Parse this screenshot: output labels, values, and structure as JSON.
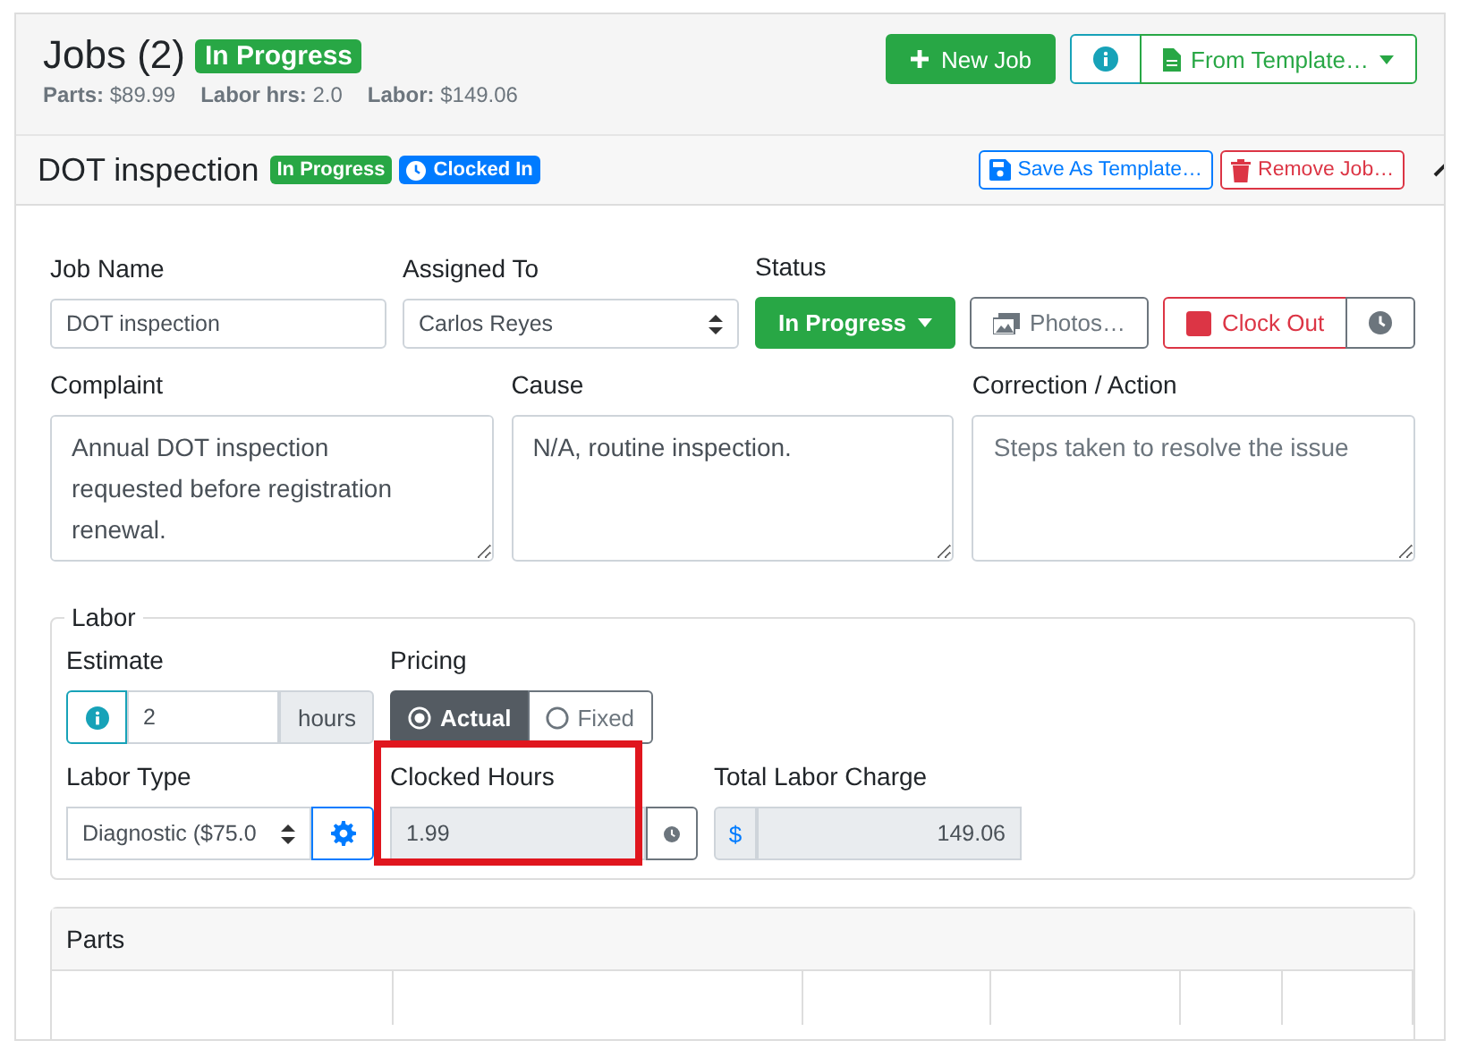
{
  "header": {
    "title": "Jobs (2)",
    "status_badge": "In Progress",
    "summary": [
      {
        "label": "Parts:",
        "value": "$89.99"
      },
      {
        "label": "Labor hrs:",
        "value": "2.0"
      },
      {
        "label": "Labor:",
        "value": "$149.06"
      }
    ],
    "new_job_button": "New Job",
    "from_template_button": "From Template…"
  },
  "job": {
    "title": "DOT inspection",
    "expanded": true,
    "badges": [
      {
        "kind": "status",
        "text": "In Progress"
      },
      {
        "kind": "clock",
        "text": "Clocked In"
      }
    ],
    "save_template_button": "Save As Template…",
    "remove_button": "Remove Job…",
    "job_name": {
      "label": "Job Name",
      "value": "DOT inspection"
    },
    "assigned_to": {
      "label": "Assigned To",
      "value": "Carlos Reyes"
    },
    "status": {
      "label": "Status",
      "value": "In Progress"
    },
    "photos_button": "Photos…",
    "clock_out_button": "Clock Out",
    "notes": [
      {
        "label": "Complaint",
        "value": "Annual DOT inspection requested before registration renewal."
      },
      {
        "label": "Cause",
        "value": "N/A, routine inspection."
      },
      {
        "label": "Correction / Action",
        "placeholder": "Steps taken to resolve the issue"
      }
    ],
    "labor": {
      "legend": "Labor",
      "estimate": {
        "label": "Estimate",
        "value": "2",
        "unit": "hours"
      },
      "pricing": {
        "label": "Pricing",
        "options": [
          {
            "label": "Actual",
            "selected": true
          },
          {
            "label": "Fixed",
            "selected": false
          }
        ]
      },
      "labor_type": {
        "label": "Labor Type",
        "value": "Diagnostic ($75.0"
      },
      "clocked_hours": {
        "label": "Clocked Hours",
        "value": "1.99",
        "highlighted": true
      },
      "total": {
        "label": "Total Labor Charge",
        "prefix": "$",
        "value": "149.06"
      }
    },
    "parts": {
      "title": "Parts"
    }
  }
}
